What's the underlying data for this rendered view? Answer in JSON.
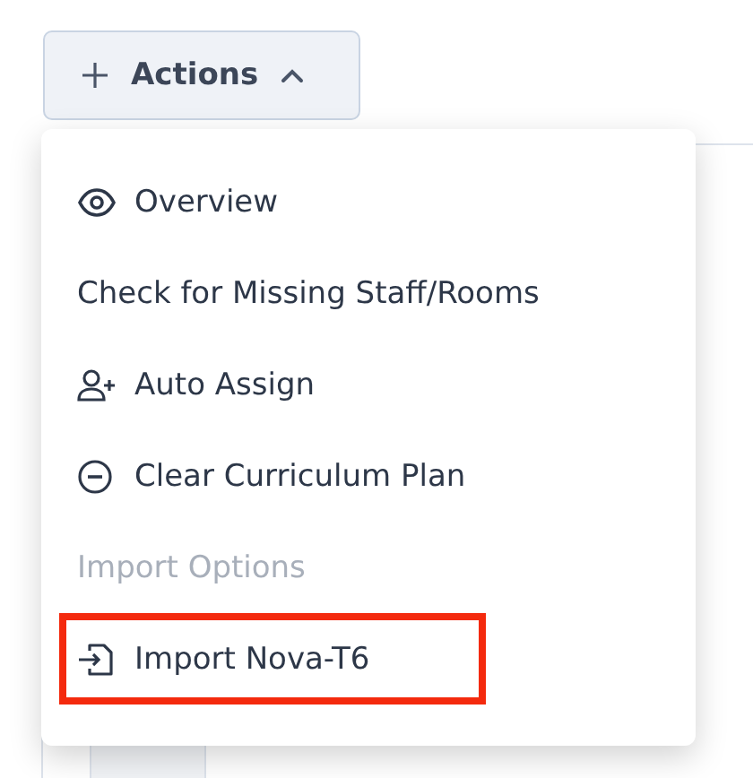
{
  "actions_button": {
    "label": "Actions",
    "expanded": true
  },
  "menu": {
    "items": [
      {
        "kind": "item",
        "label": "Overview",
        "highlighted": false
      },
      {
        "kind": "item",
        "label": "Check for Missing Staff/Rooms",
        "highlighted": false
      },
      {
        "kind": "item",
        "label": "Auto Assign",
        "highlighted": false
      },
      {
        "kind": "item",
        "label": "Clear Curriculum Plan",
        "highlighted": false
      },
      {
        "kind": "header",
        "label": "Import Options"
      },
      {
        "kind": "item",
        "label": "Import Nova-T6",
        "highlighted": true
      }
    ]
  }
}
